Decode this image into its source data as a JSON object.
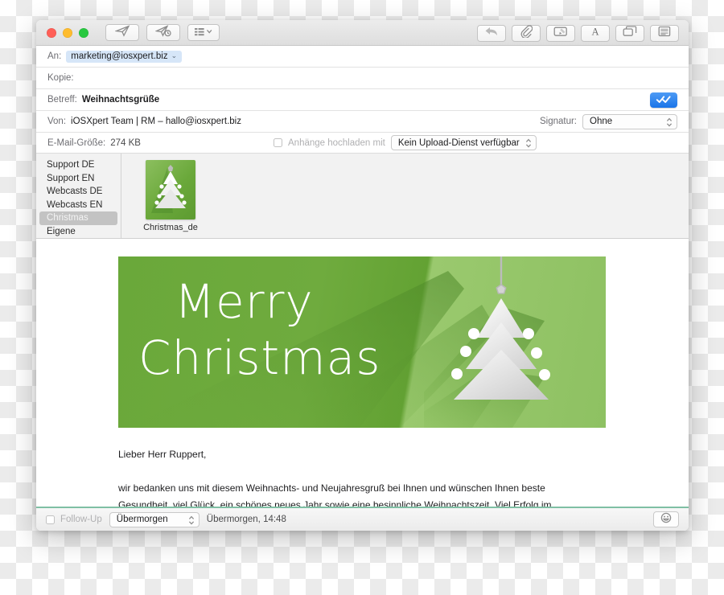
{
  "window": {
    "traffic_lights": [
      {
        "name": "close",
        "color": "#ff5f57"
      },
      {
        "name": "minimize",
        "color": "#febc2e"
      },
      {
        "name": "zoom",
        "color": "#28c840"
      }
    ]
  },
  "toolbar": {
    "left": [
      {
        "name": "send-button",
        "icon": "paper-plane-icon",
        "label": "Senden"
      },
      {
        "name": "send-later-button",
        "icon": "paper-plane-clock-icon",
        "label": "Später senden"
      },
      {
        "name": "header-fields-button",
        "icon": "list-chevron-icon",
        "label": "Kopfzeilenfelder"
      }
    ],
    "right": [
      {
        "name": "reply-button",
        "icon": "reply-arrow-icon",
        "label": "Antworten"
      },
      {
        "name": "attach-button",
        "icon": "paperclip-icon",
        "label": "Anhang hinzufügen"
      },
      {
        "name": "markup-button",
        "icon": "markup-icon",
        "label": "Markierung"
      },
      {
        "name": "format-button",
        "icon": "letter-a-icon",
        "label": "Format"
      },
      {
        "name": "photo-browser-button",
        "icon": "photo-browser-icon",
        "label": "Fotoübersicht"
      },
      {
        "name": "stationery-button",
        "icon": "stationery-icon",
        "label": "Briefpapier"
      }
    ]
  },
  "fields": {
    "to": {
      "label": "An:",
      "value": "marketing@iosxpert.biz",
      "chevron": "⌄"
    },
    "cc": {
      "label": "Kopie:",
      "value": "",
      "placeholder": ""
    },
    "subject": {
      "label": "Betreff:",
      "value": "Weihnachtsgrüße"
    },
    "from": {
      "label": "Von:",
      "value": "iOSXpert Team | RM – hallo@iosxpert.biz"
    },
    "signature": {
      "label": "Signatur:",
      "value": "Ohne"
    },
    "size": {
      "label": "E-Mail-Größe:",
      "value": "274 KB"
    },
    "upload": {
      "checkbox_label": "Anhänge hochladen mit",
      "checked": false,
      "service": "Kein Upload-Dienst verfügbar"
    },
    "send_badge": {
      "name": "send-confirm-badge",
      "icon": "double-check-icon",
      "color": "#1a74e8"
    }
  },
  "stationery": {
    "categories": [
      {
        "label": "Support DE",
        "selected": false
      },
      {
        "label": "Support EN",
        "selected": false
      },
      {
        "label": "Webcasts DE",
        "selected": false
      },
      {
        "label": "Webcasts EN",
        "selected": false
      },
      {
        "label": "Christmas",
        "selected": true
      },
      {
        "label": "Eigene",
        "selected": false
      }
    ],
    "templates": [
      {
        "label": "Christmas_de",
        "selected": false
      }
    ]
  },
  "message": {
    "banner": {
      "line1": "Merry",
      "line2": "Christmas",
      "background_color": "#6aa83a",
      "tree_color": "#ffffff",
      "ornament_count": 6
    },
    "greeting": "Lieber Herr Ruppert,",
    "paragraph1_line1": "wir bedanken uns mit diesem Weihnachts- und Neujahresgruß bei Ihnen und wünschen Ihnen beste",
    "paragraph1_line2": "Gesundheit, viel Glück, ein schönes neues Jahr sowie eine besinnliche Weihnachtszeit. Viel Erfolg im"
  },
  "bottom_bar": {
    "followup_label": "Follow-Up",
    "followup_checked": false,
    "followup_select": "Übermorgen",
    "followup_date": "Übermorgen, 14:48",
    "emoji_button": {
      "name": "emoji-button",
      "icon": "smiley-icon"
    },
    "accent_color": "#7fbfa4"
  }
}
